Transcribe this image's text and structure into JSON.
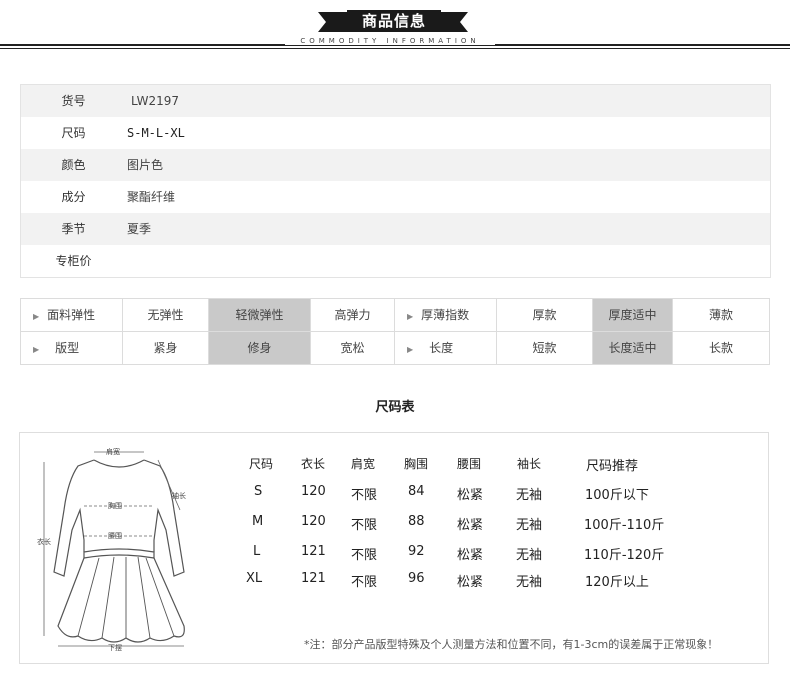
{
  "header": {
    "title": "商品信息",
    "subtitle": "COMMODITY INFORMATION"
  },
  "info": [
    {
      "key": "货号",
      "value": "LW2197"
    },
    {
      "key": "尺码",
      "value": "S-M-L-XL"
    },
    {
      "key": "颜色",
      "value": "图片色"
    },
    {
      "key": "成分",
      "value": "聚酯纤维"
    },
    {
      "key": "季节",
      "value": "夏季"
    },
    {
      "key": "专柜价",
      "value": ""
    }
  ],
  "attributes": {
    "row1": {
      "label": "面料弹性",
      "options": [
        "无弹性",
        "轻微弹性",
        "高弹力"
      ],
      "selected": "轻微弹性",
      "label2": "厚薄指数",
      "options2": [
        "厚款",
        "厚度适中",
        "薄款"
      ],
      "selected2": "厚度适中"
    },
    "row2": {
      "label": "版型",
      "options": [
        "紧身",
        "修身",
        "宽松"
      ],
      "selected": "修身",
      "label2": "长度",
      "options2": [
        "短款",
        "长度适中",
        "长款"
      ],
      "selected2": "长度适中"
    }
  },
  "size_chart": {
    "title": "尺码表",
    "diagram_labels": {
      "shoulder": "肩宽",
      "sleeve": "袖长",
      "bust": "胸围",
      "waist": "腰围",
      "length": "衣长",
      "hem": "下摆"
    },
    "headers": [
      "尺码",
      "衣长",
      "肩宽",
      "胸围",
      "腰围",
      "袖长",
      "尺码推荐"
    ],
    "rows": [
      [
        "S",
        "120",
        "不限",
        "84",
        "松紧",
        "无袖",
        "100斤以下"
      ],
      [
        "M",
        "120",
        "不限",
        "88",
        "松紧",
        "无袖",
        "100斤-110斤"
      ],
      [
        "L",
        "121",
        "不限",
        "92",
        "松紧",
        "无袖",
        "110斤-120斤"
      ],
      [
        "XL",
        "121",
        "不限",
        "96",
        "松紧",
        "无袖",
        "120斤以上"
      ]
    ],
    "note": "*注：部分产品版型特殊及个人测量方法和位置不同，有1-3cm的误差属于正常现象！"
  }
}
